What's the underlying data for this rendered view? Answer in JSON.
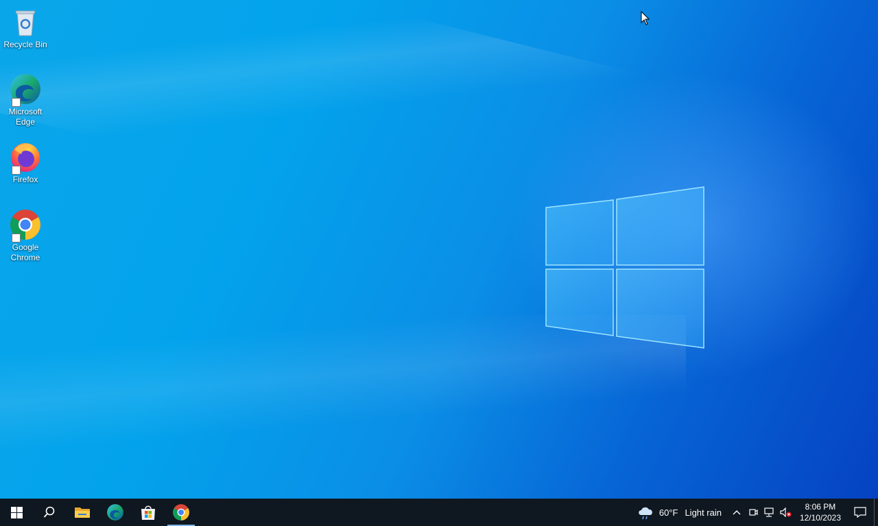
{
  "desktop": {
    "icons": [
      {
        "label": "Recycle Bin",
        "icon": "recycle-bin-icon"
      },
      {
        "label": "Microsoft Edge",
        "icon": "edge-icon"
      },
      {
        "label": "Firefox",
        "icon": "firefox-icon"
      },
      {
        "label": "Google Chrome",
        "icon": "chrome-icon"
      }
    ]
  },
  "taskbar": {
    "pinned": [
      {
        "icon": "windows-start-icon"
      },
      {
        "icon": "search-icon"
      },
      {
        "icon": "file-explorer-icon"
      },
      {
        "icon": "edge-icon"
      },
      {
        "icon": "microsoft-store-icon"
      },
      {
        "icon": "chrome-icon",
        "active": true
      }
    ],
    "weather": {
      "temperature": "60°F",
      "condition": "Light rain",
      "icon": "cloud-rain-icon"
    },
    "clock": {
      "time": "8:06 PM",
      "date": "12/10/2023"
    },
    "tray_icons": [
      "chevron-up-icon",
      "meet-now-icon",
      "network-icon",
      "volume-muted-icon"
    ]
  },
  "colors": {
    "taskbar_bg": "#0f1720",
    "accent": "#0078d7"
  }
}
